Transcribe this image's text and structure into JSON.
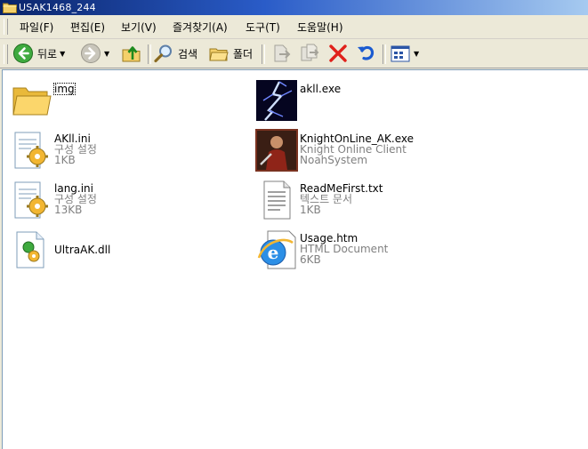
{
  "window": {
    "title": "USAK1468_244"
  },
  "menu": [
    {
      "label": "파일(F)",
      "key": "file"
    },
    {
      "label": "편집(E)",
      "key": "edit"
    },
    {
      "label": "보기(V)",
      "key": "view"
    },
    {
      "label": "즐겨찾기(A)",
      "key": "favorites"
    },
    {
      "label": "도구(T)",
      "key": "tools"
    },
    {
      "label": "도움말(H)",
      "key": "help"
    }
  ],
  "toolbar": {
    "back_label": "뒤로",
    "search_label": "검색",
    "folders_label": "폴더"
  },
  "files": [
    {
      "name": "img",
      "type": "",
      "size": "",
      "icon": "folder-icon"
    },
    {
      "name": "akll.exe",
      "type": "",
      "size": "",
      "icon": "lightning-exe-icon"
    },
    {
      "name": "AKll.ini",
      "type": "구성 설정",
      "size": "1KB",
      "icon": "config-file-icon"
    },
    {
      "name": "KnightOnLine_AK.exe",
      "type": "Knight Online Client",
      "size": "NoahSystem",
      "icon": "knight-online-icon"
    },
    {
      "name": "lang.ini",
      "type": "구성 설정",
      "size": "13KB",
      "icon": "config-file-icon"
    },
    {
      "name": "ReadMeFirst.txt",
      "type": "텍스트 문서",
      "size": "1KB",
      "icon": "text-file-icon"
    },
    {
      "name": "UltraAK.dll",
      "type": "",
      "size": "",
      "icon": "dll-file-icon"
    },
    {
      "name": "Usage.htm",
      "type": "HTML Document",
      "size": "6KB",
      "icon": "ie-html-icon"
    }
  ]
}
